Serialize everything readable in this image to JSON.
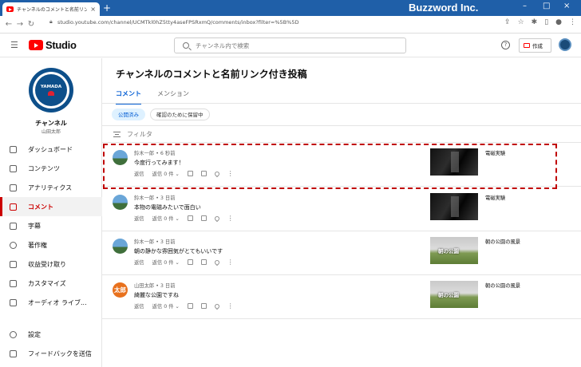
{
  "browser": {
    "tab_title": "チャンネルのコメントと名前リンク付きさ",
    "new_tab": "+",
    "url": "studio.youtube.com/channel/UCMTkl0hZ5tty4aseFPSRxmQ/comments/inbox?filter=%5B%5D",
    "watermark": "Buzzword Inc."
  },
  "header": {
    "logo_text": "Studio",
    "search_placeholder": "チャンネル内で検索",
    "help": "?",
    "create_label": "作成"
  },
  "channel": {
    "avatar_text": "YAMADA",
    "name": "チャンネル",
    "owner": "山田太郎"
  },
  "sidebar": {
    "items": [
      {
        "label": "ダッシュボード"
      },
      {
        "label": "コンテンツ"
      },
      {
        "label": "アナリティクス"
      },
      {
        "label": "コメント"
      },
      {
        "label": "字幕"
      },
      {
        "label": "著作権"
      },
      {
        "label": "収益受け取り"
      },
      {
        "label": "カスタマイズ"
      },
      {
        "label": "オーディオ ライブ..."
      }
    ],
    "bottom": [
      {
        "label": "設定"
      },
      {
        "label": "フィードバックを送信"
      }
    ]
  },
  "main": {
    "title": "チャンネルのコメントと名前リンク付き投稿",
    "tabs": [
      {
        "label": "コメント"
      },
      {
        "label": "メンション"
      }
    ],
    "chips": [
      {
        "label": "公開済み"
      },
      {
        "label": "確認のために保留中"
      }
    ],
    "filter_label": "フィルタ",
    "reply_label": "返信",
    "replies_label": "返信 0 件",
    "comments": [
      {
        "meta": "鈴木一郎 • 6 秒前",
        "text": "今度行ってみます！",
        "video": "電磁実験",
        "avatar": "",
        "thumb_caption": ""
      },
      {
        "meta": "鈴木一郎 • 3 日前",
        "text": "本物の電磁みたいで面白い",
        "video": "電磁実験",
        "avatar": "",
        "thumb_caption": ""
      },
      {
        "meta": "鈴木一郎 • 3 日前",
        "text": "朝の静かな雰囲気がとてもいいです",
        "video": "朝の公園の風景",
        "avatar": "",
        "thumb_caption": "朝の公園"
      },
      {
        "meta": "山田太郎 • 3 日前",
        "text": "綺麗な公園ですね",
        "video": "朝の公園の風景",
        "avatar": "太郎",
        "thumb_caption": "朝の公園"
      }
    ]
  }
}
